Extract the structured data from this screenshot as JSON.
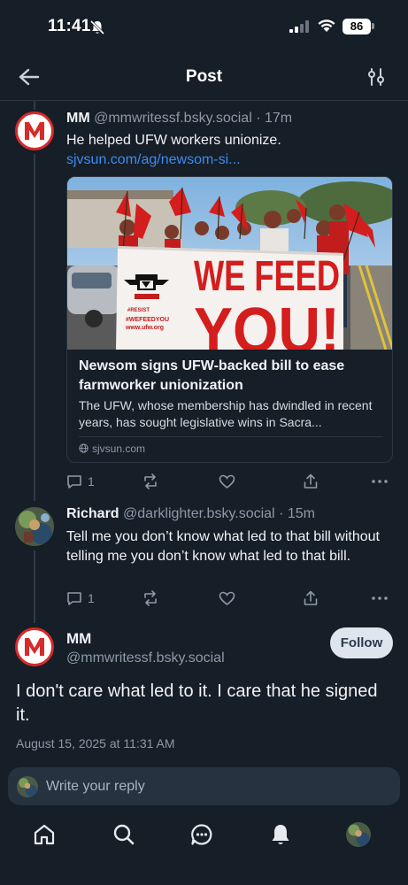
{
  "status_bar": {
    "time": "11:41",
    "battery": "86"
  },
  "header": {
    "title": "Post"
  },
  "posts": [
    {
      "name": "MM",
      "handle": "@mmwritessf.bsky.social",
      "time_ago": "· 17m",
      "text": "He helped UFW workers unionize.",
      "link": "sjvsun.com/ag/newsom-si...",
      "card": {
        "title": "Newsom signs UFW-backed bill to ease farmworker unionization",
        "description": "The UFW, whose membership has dwindled in recent years, has sought legislative wins in Sacra...",
        "domain": "sjvsun.com",
        "banner_text_1": "WE FEED",
        "banner_text_2": "YOU!",
        "banner_small_1": "#RESIST",
        "banner_small_2": "#WEFEEDYOU",
        "banner_small_3": "www.ufw.org"
      },
      "replies": "1"
    },
    {
      "name": "Richard",
      "handle": "@darklighter.bsky.social",
      "time_ago": "· 15m",
      "text": "Tell me you don’t know what led to that bill without telling me you don’t know what led to that bill.",
      "replies": "1"
    }
  ],
  "main_post": {
    "name": "MM",
    "handle": "@mmwritessf.bsky.social",
    "follow_label": "Follow",
    "text": "I don't care what led to it. I care that he signed it.",
    "timestamp": "August 15, 2025 at 11:31 AM"
  },
  "reply_box": {
    "placeholder": "Write your reply"
  },
  "colors": {
    "background": "#161e27",
    "accent": "#3b8cf2",
    "muted": "#8d9aa9",
    "mm_red": "#d72a2a"
  },
  "tabs": [
    "home-icon",
    "search-icon",
    "chat-icon",
    "bell-icon",
    "profile-avatar"
  ]
}
